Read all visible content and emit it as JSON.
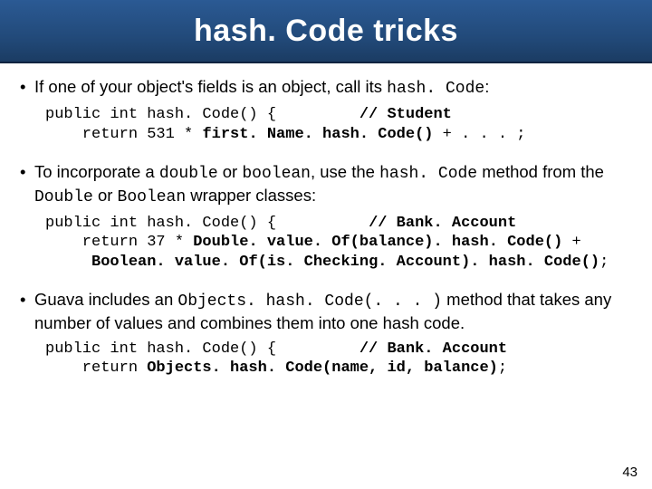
{
  "title": "hash. Code tricks",
  "bullets": [
    {
      "pre": "If one of your object's fields is an object, call its ",
      "mono": "hash. Code",
      "post": ":"
    },
    {
      "pre": "To incorporate a ",
      "m1": "double",
      "mid1": " or ",
      "m2": "boolean",
      "mid2": ", use the ",
      "m3": "hash. Code",
      "post1": " method from the ",
      "m4": "Double",
      "mid3": " or ",
      "m5": "Boolean",
      "post2": " wrapper classes:"
    },
    {
      "pre": "Guava includes an ",
      "mono": "Objects. hash. Code(. . . )",
      "post": " method that takes any number of values and combines them into one hash code."
    }
  ],
  "code1": {
    "l1a": "public int hash. Code() {         ",
    "l1b": "// Student",
    "l2a": "    return 531 * ",
    "l2b": "first. Name. hash. Code()",
    "l2c": " + . . . ;"
  },
  "code2": {
    "l1a": "public int hash. Code() {          ",
    "l1b": "// Bank. Account",
    "l2a": "    return 37 * ",
    "l2b": "Double. value. Of(balance). hash. Code()",
    "l2c": " +",
    "l3a": "     ",
    "l3b": "Boolean. value. Of(is. Checking. Account). hash. Code()",
    "l3c": ";"
  },
  "code3": {
    "l1a": "public int hash. Code() {         ",
    "l1b": "// Bank. Account",
    "l2a": "    return ",
    "l2b": "Objects. hash. Code(name, id, balance)",
    "l2c": ";"
  },
  "page_number": "43"
}
